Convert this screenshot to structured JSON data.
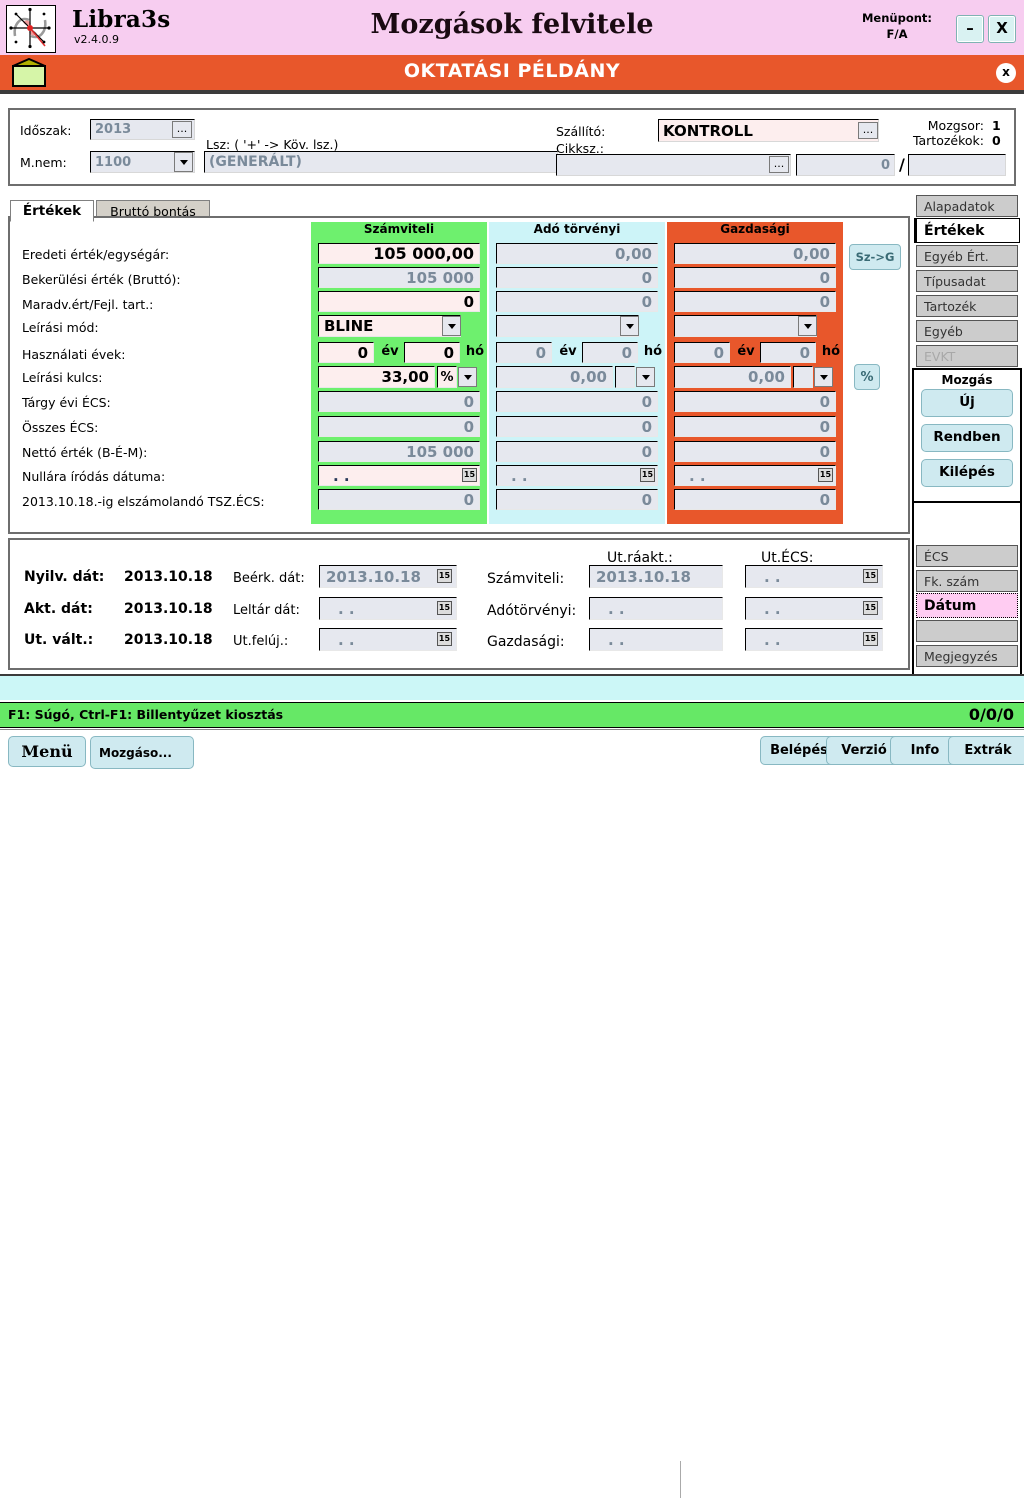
{
  "titlebar": {
    "brand": "Libra3s",
    "version": "v2.4.0.9",
    "window_title": "Mozgások felvitele",
    "menupoint_label": "Menüpont:",
    "menupoint_value": "F/A",
    "minimize": "–",
    "close": "X",
    "logo_icon": "compass-starburst-icon"
  },
  "banner": {
    "text": "OKTATÁSI PÉLDÁNY",
    "icon": "envelope-icon",
    "close": "x"
  },
  "header": {
    "idoszak_label": "Időszak:",
    "idoszak_value": "2013",
    "mnem_label": "M.nem:",
    "mnem_value": "1100",
    "lsz_label": "Lsz: ( '+' -> Köv. lsz.)",
    "lsz_value": "(GENERÁLT)",
    "szallito_label": "Szállító:",
    "szallito_value": "KONTROLL",
    "cikksz_label": "Cikksz.:",
    "cikksz_value": "",
    "qty_value": "0",
    "qty_sep": "/",
    "qty_unit": "",
    "mozgsor_label": "Mozgsor:",
    "mozgsor_value": "1",
    "tartozekok_label": "Tartozékok:",
    "tartozekok_value": "0",
    "dots": "..."
  },
  "tabs": [
    {
      "label": "Értékek",
      "active": true
    },
    {
      "label": "Bruttó bontás",
      "active": false
    }
  ],
  "columns": [
    {
      "key": "acc",
      "header": "Számviteli",
      "color": "#6ef06e"
    },
    {
      "key": "tax",
      "header": "Adó törvényi",
      "color": "#cdf4f8"
    },
    {
      "key": "eco",
      "header": "Gazdasági",
      "color": "#e8572b"
    }
  ],
  "rows": [
    {
      "label": "Eredeti érték/egységár:",
      "acc": "105 000,00",
      "tax": "0,00",
      "eco": "0,00",
      "acc_edit": true
    },
    {
      "label": "Bekerülési érték (Bruttó):",
      "acc": "105 000",
      "tax": "0",
      "eco": "0",
      "acc_edit": false
    },
    {
      "label": "Maradv.ért/Fejl. tart.:",
      "acc": "0",
      "tax": "0",
      "eco": "0",
      "acc_edit": true
    },
    {
      "label": "Leírási mód:",
      "acc": "BLINE",
      "tax": "",
      "eco": "",
      "acc_edit": true,
      "type": "select"
    },
    {
      "label": "Használati évek:",
      "acc_years": "0",
      "acc_months": "0",
      "tax_years": "0",
      "tax_months": "0",
      "eco_years": "0",
      "eco_months": "0",
      "unit_year": "év",
      "unit_month": "hó",
      "type": "years"
    },
    {
      "label": "Leírási kulcs:",
      "acc": "33,00",
      "tax": "0,00",
      "eco": "0,00",
      "acc_edit": true,
      "type": "pct",
      "pct_symbol": "%"
    },
    {
      "label": "Tárgy évi ÉCS:",
      "acc": "0",
      "tax": "0",
      "eco": "0",
      "acc_edit": false
    },
    {
      "label": "Összes ÉCS:",
      "acc": "0",
      "tax": "0",
      "eco": "0",
      "acc_edit": false
    },
    {
      "label": "Nettó érték (B-É-M):",
      "acc": "105 000",
      "tax": "0",
      "eco": "0",
      "acc_edit": false
    },
    {
      "label": "Nullára íródás dátuma:",
      "acc": ". .",
      "tax": ". .",
      "eco": ". .",
      "acc_edit": true,
      "type": "date"
    },
    {
      "label": "2013.10.18.-ig elszámolandó TSZ.ÉCS:",
      "acc": "0",
      "tax": "0",
      "eco": "0",
      "acc_edit": false
    }
  ],
  "side_actions": {
    "sz_to_g": "Sz->G",
    "percent": "%"
  },
  "sidebar": {
    "items": [
      {
        "label": "Alapadatok",
        "state": "normal"
      },
      {
        "label": "Értékek",
        "state": "selected"
      },
      {
        "label": "Egyéb Ért.",
        "state": "normal"
      },
      {
        "label": "Típusadat",
        "state": "normal"
      },
      {
        "label": "Tartozék",
        "state": "normal"
      },
      {
        "label": "Egyéb",
        "state": "normal"
      },
      {
        "label": "EVKT",
        "state": "disabled"
      }
    ],
    "group_title": "Mozgás",
    "group_buttons": [
      {
        "label": "Új"
      },
      {
        "label": "Rendben"
      },
      {
        "label": "Kilépés"
      }
    ],
    "lower_items": [
      {
        "label": "ÉCS",
        "state": "normal"
      },
      {
        "label": "Fk. szám",
        "state": "normal"
      },
      {
        "label": "Dátum",
        "state": "pink-selected"
      },
      {
        "label": "",
        "state": "normal"
      },
      {
        "label": "Megjegyzés",
        "state": "normal"
      }
    ]
  },
  "dates": {
    "left": [
      {
        "label": "Nyilv. dát:",
        "value": "2013.10.18"
      },
      {
        "label": "Akt. dát:",
        "value": "2013.10.18"
      },
      {
        "label": "Ut. vált.:",
        "value": "2013.10.18"
      }
    ],
    "mid": [
      {
        "label": "Beérk. dát:",
        "value": "2013.10.18"
      },
      {
        "label": "Leltár dát:",
        "value": ". ."
      },
      {
        "label": "Ut.felúj.:",
        "value": ". ."
      }
    ],
    "col_head_1": "Ut.ráakt.:",
    "col_head_2": "Ut.ÉCS:",
    "right": [
      {
        "label": "Számviteli:",
        "raakt": "2013.10.18",
        "ecs": ". ."
      },
      {
        "label": "Adótörvényi:",
        "raakt": ". .",
        "ecs": ". ."
      },
      {
        "label": "Gazdasági:",
        "raakt": ". .",
        "ecs": ". ."
      }
    ],
    "cal_icon": "15"
  },
  "statusbar": {
    "hint": "F1: Súgó, Ctrl-F1: Billentyűzet kiosztás",
    "counter": "0/0/0"
  },
  "bottombar": {
    "menu": "Menü",
    "task": "Mozgáso...",
    "right_buttons": [
      "Belépés",
      "Verzió",
      "Info",
      "Extrák"
    ]
  },
  "colors": {
    "title_bg": "#f7cdf0",
    "banner_bg": "#e8572b",
    "accounting": "#6ef06e",
    "tax": "#cdf4f8",
    "economic": "#e8572b",
    "status_bg": "#66e866",
    "cyan_bg": "#ccf7f7",
    "pink_field": "#fdeeee",
    "gray_field": "#e6e8ef"
  }
}
